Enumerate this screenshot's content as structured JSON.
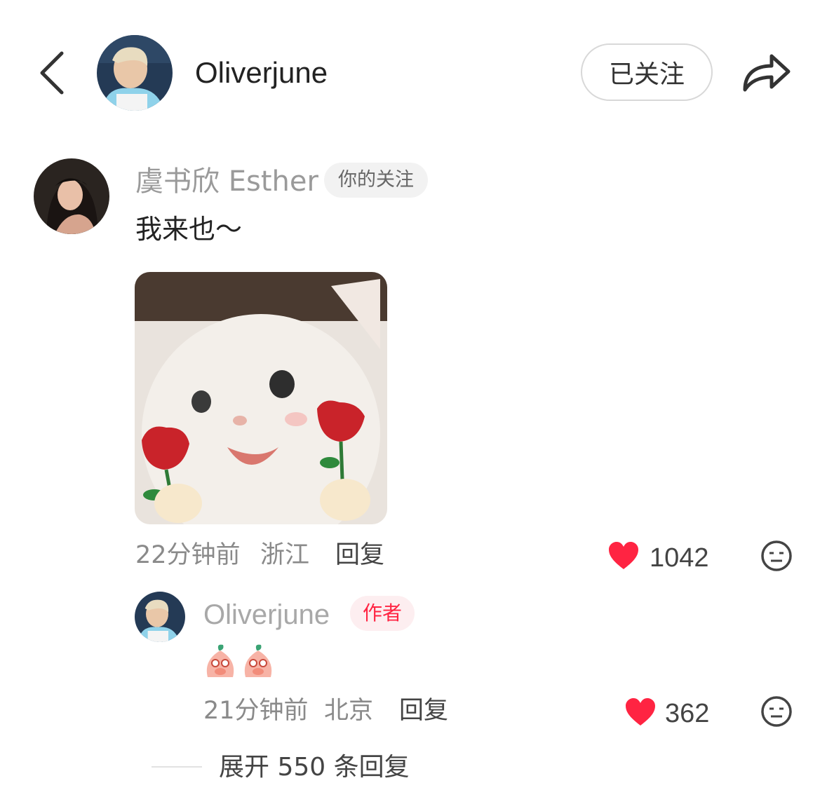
{
  "header": {
    "username": "Oliverjune",
    "follow_label": "已关注",
    "icons": {
      "back": "chevron-left-icon",
      "share": "share-arrow-icon"
    }
  },
  "comment": {
    "author": "虞书欣 Esther",
    "badge": "你的关注",
    "text": "我来也～",
    "image": "white-kitten-holding-roses-sticker",
    "time": "22分钟前",
    "location": "浙江",
    "reply_label": "回复",
    "likes": "1042"
  },
  "reply": {
    "author": "Oliverjune",
    "badge": "作者",
    "emojis": "peach-covering-mouth-emoji ×2",
    "time": "21分钟前",
    "location": "北京",
    "reply_label": "回复",
    "likes": "362"
  },
  "expand": {
    "label": "展开 550 条回复"
  },
  "colors": {
    "like": "#ff2442",
    "author_badge": "#ff2442",
    "muted": "#9a9a9a"
  }
}
